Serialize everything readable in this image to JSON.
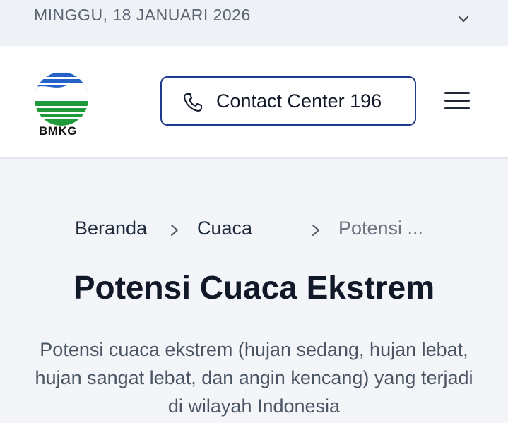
{
  "topbar": {
    "date": "MINGGU, 18 JANUARI 2026"
  },
  "header": {
    "logo_text": "BMKG",
    "contact_label": "Contact Center 196"
  },
  "breadcrumb": [
    {
      "label": "Beranda"
    },
    {
      "label": "Cuaca"
    },
    {
      "label": "Potensi ..."
    }
  ],
  "page": {
    "title": "Potensi Cuaca Ekstrem",
    "description": "Potensi cuaca ekstrem (hujan sedang, hujan lebat, hujan sangat lebat, dan angin kencang) yang terjadi di wilayah Indonesia"
  },
  "colors": {
    "accent": "#1f3a8a",
    "text": "#111827",
    "muted": "#6b7280",
    "background": "#f3f5f9"
  }
}
